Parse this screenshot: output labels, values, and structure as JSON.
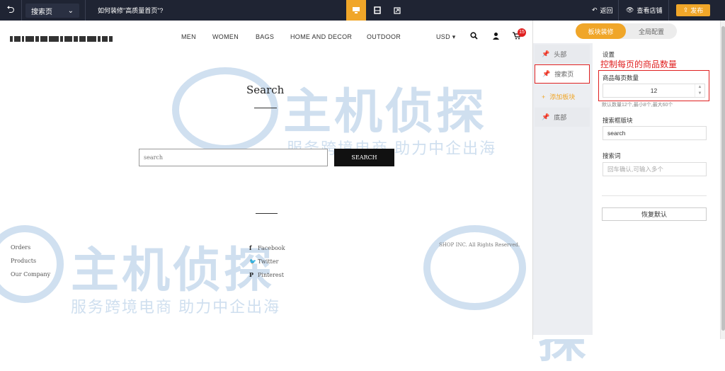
{
  "topbar": {
    "exit_icon": "exit-icon",
    "page_select_value": "搜索页",
    "help_title": "如何装修\"高质量首页\"?",
    "back_label": "返回",
    "view_store_label": "查看店铺",
    "publish_label": "发布"
  },
  "nav": {
    "items": [
      "MEN",
      "WOMEN",
      "BAGS",
      "HOME AND DECOR",
      "OUTDOOR"
    ],
    "currency": "USD ▾",
    "cart_count": "15"
  },
  "page": {
    "title": "Search",
    "search_placeholder": "search",
    "search_button": "SEARCH"
  },
  "footer": {
    "links": [
      "Orders",
      "Products",
      "Our Company"
    ],
    "social": [
      "Facebook",
      "Twitter",
      "Pinterest"
    ],
    "copyright": "SHOP INC. All Rights Reserved."
  },
  "watermark": {
    "brand": "主机侦探",
    "slogan": "服务跨境电商 助力中企出海"
  },
  "panel": {
    "tabs": [
      "板块装修",
      "全局配置"
    ],
    "sections": [
      "头部",
      "搜索页",
      "添加板块",
      "底部"
    ],
    "settings_heading": "设置",
    "annotation": "控制每页的商品数量",
    "per_page_label": "商品每页数量",
    "per_page_value": "12",
    "per_page_hint": "默认数量12个,最小8个,最大60个",
    "block_title_label": "搜索框版块",
    "block_title_value": "search",
    "search_terms_label": "搜索词",
    "search_terms_placeholder": "回车确认,可输入多个",
    "reset_label": "恢复默认"
  },
  "colors": {
    "accent": "#f0a629",
    "topbar": "#1f2433",
    "highlight": "#e02020"
  }
}
